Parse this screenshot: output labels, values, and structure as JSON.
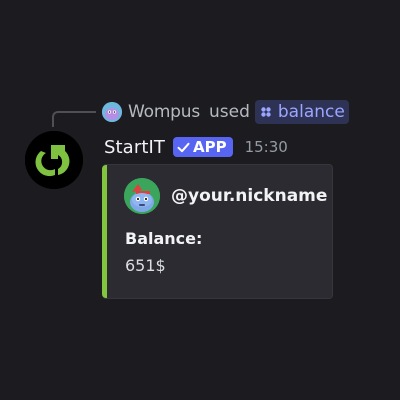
{
  "interaction": {
    "user_name": "Wompus",
    "used_text": "used",
    "command_name": "balance"
  },
  "message": {
    "bot_name": "StartIT",
    "app_tag": "APP",
    "timestamp": "15:30"
  },
  "embed": {
    "author": "@your.nickname",
    "field_name": "Balance:",
    "field_value": "651$",
    "accent_color": "#82c63f"
  },
  "icons": {
    "reply_avatar": "wompus-avatar-icon",
    "command": "slash-command-icon",
    "bot_avatar": "startit-logo-icon",
    "app_check": "checkmark-icon",
    "author_avatar": "wumpus-avatar-icon"
  }
}
